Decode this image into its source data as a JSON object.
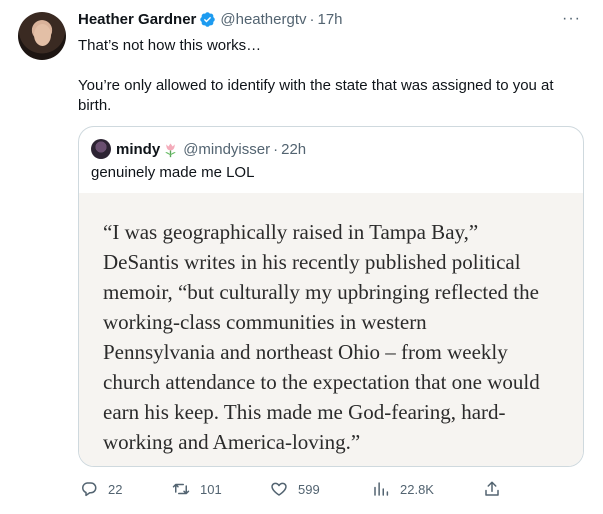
{
  "tweet": {
    "author_name": "Heather Gardner",
    "author_handle": "@heathergtv",
    "separator": "·",
    "time": "17h",
    "more_label": "···",
    "text_line1": "That’s not how this works…",
    "text_line2": "You’re only allowed to identify with the state that was assigned to you at birth."
  },
  "quote": {
    "author_name": "mindy",
    "author_handle": "@mindyisser",
    "separator": "·",
    "time": "22h",
    "text": "genuinely made me LOL",
    "image_text": "“I was geographically raised in Tampa Bay,” DeSantis writes in his recently published political memoir, “but culturally my upbringing reflected the working-class communities in western Pennsylvania and northeast Ohio – from weekly church attendance to the expectation that one would earn his keep. This made me God-fearing, hard-working and America-loving.”"
  },
  "actions": {
    "replies": "22",
    "retweets": "101",
    "likes": "599",
    "views": "22.8K"
  },
  "icons": {
    "verified": "verified-badge-icon",
    "quote_emoji": "tulip-emoji-icon",
    "reply": "reply-icon",
    "retweet": "retweet-icon",
    "like": "heart-icon",
    "views": "views-chart-icon",
    "share": "share-icon"
  },
  "colors": {
    "verified_blue": "#1d9bf0",
    "muted_text": "#536471",
    "border": "#cfd9de",
    "tulip_pink": "#f4abba"
  }
}
